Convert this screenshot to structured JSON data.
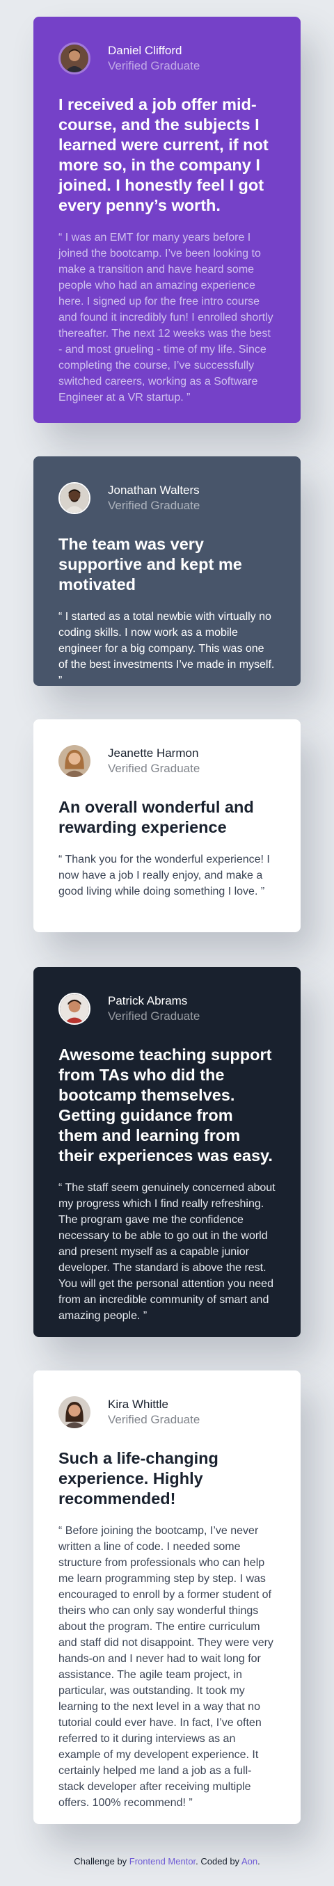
{
  "testimonials": [
    {
      "name": "Daniel Clifford",
      "role": "Verified Graduate",
      "headline": "I received a job offer mid-course, and the subjects I learned were current, if not more so, in the company I joined. I honestly feel I got every penny’s worth.",
      "quote": "“ I was an EMT for many years before I joined the bootcamp. I’ve been looking to make a transition and have heard some people who had an amazing experience here. I signed up for the free intro course and found it incredibly fun! I enrolled shortly thereafter. The next 12 weeks was the best - and most grueling - time of my life. Since completing the course, I’ve successfully switched careers, working as a Software Engineer at a VR startup. ”",
      "avatar_icon": "avatar-daniel-icon"
    },
    {
      "name": "Jonathan Walters",
      "role": "Verified Graduate",
      "headline": "The team was very supportive and kept me motivated",
      "quote": "“ I started as a total newbie with virtually no coding skills. I now work as a mobile engineer for a big company. This was one of the best investments I’ve made in myself. ”",
      "avatar_icon": "avatar-jonathan-icon"
    },
    {
      "name": "Jeanette Harmon",
      "role": "Verified Graduate",
      "headline": "An overall wonderful and rewarding experience",
      "quote": "“ Thank you for the wonderful experience! I now have a job I really enjoy, and make a good living while doing something I love. ”",
      "avatar_icon": "avatar-jeanette-icon"
    },
    {
      "name": "Patrick Abrams",
      "role": "Verified Graduate",
      "headline": "Awesome teaching support from TAs who did the bootcamp themselves. Getting guidance from them and learning from their experiences was easy.",
      "quote": "“ The staff seem genuinely concerned about my progress which I find really refreshing. The program gave me the confidence necessary to be able to go out in the world and present myself as a capable junior developer. The standard is above the rest. You will get the personal attention you need from an incredible community of smart and amazing people. ”",
      "avatar_icon": "avatar-patrick-icon"
    },
    {
      "name": "Kira Whittle",
      "role": "Verified Graduate",
      "headline": "Such a life-changing experience. Highly recommended!",
      "quote": "“ Before joining the bootcamp, I’ve never written a line of code. I needed some structure from professionals who can help me learn programming step by step. I was encouraged to enroll by a former student of theirs who can only say wonderful things about the program. The entire curriculum and staff did not disappoint. They were very hands-on and I never had to wait long for assistance. The agile team project, in particular, was outstanding. It took my learning to the next level in a way that no tutorial could ever have. In fact, I’ve often referred to it during interviews as an example of my developent experience. It certainly helped me land a job as a full-stack developer after receiving multiple offers. 100% recommend! ”",
      "avatar_icon": "avatar-kira-icon"
    }
  ],
  "footer": {
    "prefix": "Challenge by ",
    "link1": "Frontend Mentor",
    "middle": ". Coded by ",
    "link2": "Aon",
    "suffix": "."
  },
  "colors": {
    "purple": "#7541c8",
    "slate": "#48556a",
    "white": "#ffffff",
    "dark": "#19212e",
    "background": "#e7eaee",
    "link": "#6f5bd6"
  }
}
